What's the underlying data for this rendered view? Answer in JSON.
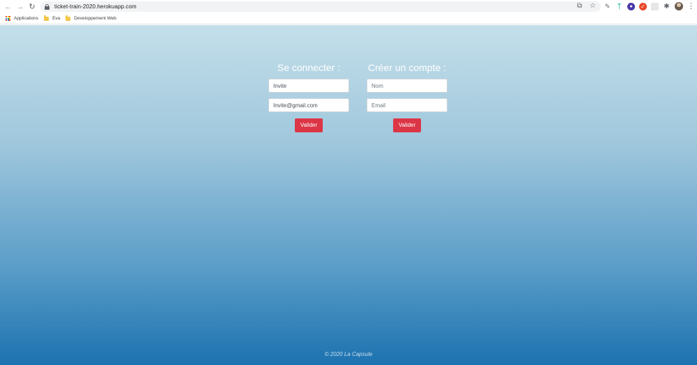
{
  "browser": {
    "url": "ticket-train-2020.herokuapp.com",
    "bookmarks": [
      {
        "label": "Applications"
      },
      {
        "label": "Eva"
      },
      {
        "label": "Developpement Web"
      }
    ]
  },
  "login": {
    "title": "Se connecter :",
    "name_value": "Invite",
    "email_value": "Invite@gmail.com",
    "submit_label": "Valider"
  },
  "signup": {
    "title": "Créer un compte :",
    "name_placeholder": "Nom",
    "email_placeholder": "Email",
    "submit_label": "Valider"
  },
  "footer": {
    "text": "© 2020 La Capsule"
  },
  "colors": {
    "button": "#dc3545",
    "gradient_top": "#c4dfea",
    "gradient_bottom": "#1c72b0"
  }
}
